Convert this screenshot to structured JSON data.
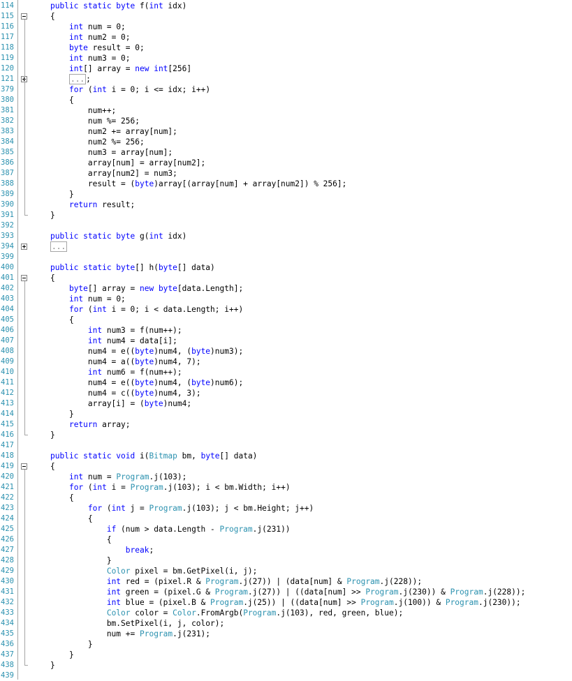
{
  "editor": {
    "language": "C#",
    "colors": {
      "keyword": "#0000ff",
      "type": "#2b91af",
      "line_number": "#2b91af",
      "text": "#000000",
      "collapsed_box": "#a5a5a5",
      "background": "#ffffff"
    },
    "lines": [
      {
        "no": "114",
        "fold": "",
        "code": [
          [
            "kw",
            "public static byte "
          ],
          [
            "n",
            "f("
          ],
          [
            "kw",
            "int "
          ],
          [
            "n",
            "idx)"
          ]
        ]
      },
      {
        "no": "115",
        "fold": "minus",
        "code": [
          [
            "n",
            "{"
          ]
        ]
      },
      {
        "no": "116",
        "fold": "",
        "code": [
          [
            "n",
            "    "
          ],
          [
            "kw",
            "int "
          ],
          [
            "n",
            "num = 0;"
          ]
        ]
      },
      {
        "no": "117",
        "fold": "",
        "code": [
          [
            "n",
            "    "
          ],
          [
            "kw",
            "int "
          ],
          [
            "n",
            "num2 = 0;"
          ]
        ]
      },
      {
        "no": "118",
        "fold": "",
        "code": [
          [
            "n",
            "    "
          ],
          [
            "kw",
            "byte "
          ],
          [
            "n",
            "result = 0;"
          ]
        ]
      },
      {
        "no": "119",
        "fold": "",
        "code": [
          [
            "n",
            "    "
          ],
          [
            "kw",
            "int "
          ],
          [
            "n",
            "num3 = 0;"
          ]
        ]
      },
      {
        "no": "120",
        "fold": "",
        "code": [
          [
            "n",
            "    "
          ],
          [
            "kw",
            "int"
          ],
          [
            "n",
            "[] array = "
          ],
          [
            "kw",
            "new int"
          ],
          [
            "n",
            "[256]"
          ]
        ]
      },
      {
        "no": "121",
        "fold": "plus",
        "code": [
          [
            "n",
            "    "
          ],
          [
            "box",
            "..."
          ],
          [
            "n",
            ";"
          ]
        ]
      },
      {
        "no": "379",
        "fold": "",
        "code": [
          [
            "n",
            "    "
          ],
          [
            "kw",
            "for "
          ],
          [
            "n",
            "("
          ],
          [
            "kw",
            "int "
          ],
          [
            "n",
            "i = 0; i <= idx; i++)"
          ]
        ]
      },
      {
        "no": "380",
        "fold": "",
        "code": [
          [
            "n",
            "    {"
          ]
        ]
      },
      {
        "no": "381",
        "fold": "",
        "code": [
          [
            "n",
            "        num++;"
          ]
        ]
      },
      {
        "no": "382",
        "fold": "",
        "code": [
          [
            "n",
            "        num %= 256;"
          ]
        ]
      },
      {
        "no": "383",
        "fold": "",
        "code": [
          [
            "n",
            "        num2 += array[num];"
          ]
        ]
      },
      {
        "no": "384",
        "fold": "",
        "code": [
          [
            "n",
            "        num2 %= 256;"
          ]
        ]
      },
      {
        "no": "385",
        "fold": "",
        "code": [
          [
            "n",
            "        num3 = array[num];"
          ]
        ]
      },
      {
        "no": "386",
        "fold": "",
        "code": [
          [
            "n",
            "        array[num] = array[num2];"
          ]
        ]
      },
      {
        "no": "387",
        "fold": "",
        "code": [
          [
            "n",
            "        array[num2] = num3;"
          ]
        ]
      },
      {
        "no": "388",
        "fold": "",
        "code": [
          [
            "n",
            "        result = ("
          ],
          [
            "kw",
            "byte"
          ],
          [
            "n",
            ")array[(array[num] + array[num2]) % 256];"
          ]
        ]
      },
      {
        "no": "389",
        "fold": "",
        "code": [
          [
            "n",
            "    }"
          ]
        ]
      },
      {
        "no": "390",
        "fold": "",
        "code": [
          [
            "n",
            "    "
          ],
          [
            "kw",
            "return "
          ],
          [
            "n",
            "result;"
          ]
        ]
      },
      {
        "no": "391",
        "fold": "end",
        "code": [
          [
            "n",
            "}"
          ]
        ]
      },
      {
        "no": "392",
        "fold": "",
        "code": []
      },
      {
        "no": "393",
        "fold": "",
        "code": [
          [
            "kw",
            "public static byte "
          ],
          [
            "n",
            "g("
          ],
          [
            "kw",
            "int "
          ],
          [
            "n",
            "idx)"
          ]
        ]
      },
      {
        "no": "394",
        "fold": "plus",
        "code": [
          [
            "box",
            "..."
          ]
        ]
      },
      {
        "no": "399",
        "fold": "",
        "code": []
      },
      {
        "no": "400",
        "fold": "",
        "code": [
          [
            "kw",
            "public static byte"
          ],
          [
            "n",
            "[] h("
          ],
          [
            "kw",
            "byte"
          ],
          [
            "n",
            "[] data)"
          ]
        ]
      },
      {
        "no": "401",
        "fold": "minus",
        "code": [
          [
            "n",
            "{"
          ]
        ]
      },
      {
        "no": "402",
        "fold": "",
        "code": [
          [
            "n",
            "    "
          ],
          [
            "kw",
            "byte"
          ],
          [
            "n",
            "[] array = "
          ],
          [
            "kw",
            "new byte"
          ],
          [
            "n",
            "[data.Length];"
          ]
        ]
      },
      {
        "no": "403",
        "fold": "",
        "code": [
          [
            "n",
            "    "
          ],
          [
            "kw",
            "int "
          ],
          [
            "n",
            "num = 0;"
          ]
        ]
      },
      {
        "no": "404",
        "fold": "",
        "code": [
          [
            "n",
            "    "
          ],
          [
            "kw",
            "for "
          ],
          [
            "n",
            "("
          ],
          [
            "kw",
            "int "
          ],
          [
            "n",
            "i = 0; i < data.Length; i++)"
          ]
        ]
      },
      {
        "no": "405",
        "fold": "",
        "code": [
          [
            "n",
            "    {"
          ]
        ]
      },
      {
        "no": "406",
        "fold": "",
        "code": [
          [
            "n",
            "        "
          ],
          [
            "kw",
            "int "
          ],
          [
            "n",
            "num3 = f(num++);"
          ]
        ]
      },
      {
        "no": "407",
        "fold": "",
        "code": [
          [
            "n",
            "        "
          ],
          [
            "kw",
            "int "
          ],
          [
            "n",
            "num4 = data[i];"
          ]
        ]
      },
      {
        "no": "408",
        "fold": "",
        "code": [
          [
            "n",
            "        num4 = e(("
          ],
          [
            "kw",
            "byte"
          ],
          [
            "n",
            ")num4, ("
          ],
          [
            "kw",
            "byte"
          ],
          [
            "n",
            ")num3);"
          ]
        ]
      },
      {
        "no": "409",
        "fold": "",
        "code": [
          [
            "n",
            "        num4 = a(("
          ],
          [
            "kw",
            "byte"
          ],
          [
            "n",
            ")num4, 7);"
          ]
        ]
      },
      {
        "no": "410",
        "fold": "",
        "code": [
          [
            "n",
            "        "
          ],
          [
            "kw",
            "int "
          ],
          [
            "n",
            "num6 = f(num++);"
          ]
        ]
      },
      {
        "no": "411",
        "fold": "",
        "code": [
          [
            "n",
            "        num4 = e(("
          ],
          [
            "kw",
            "byte"
          ],
          [
            "n",
            ")num4, ("
          ],
          [
            "kw",
            "byte"
          ],
          [
            "n",
            ")num6);"
          ]
        ]
      },
      {
        "no": "412",
        "fold": "",
        "code": [
          [
            "n",
            "        num4 = c(("
          ],
          [
            "kw",
            "byte"
          ],
          [
            "n",
            ")num4, 3);"
          ]
        ]
      },
      {
        "no": "413",
        "fold": "",
        "code": [
          [
            "n",
            "        array[i] = ("
          ],
          [
            "kw",
            "byte"
          ],
          [
            "n",
            ")num4;"
          ]
        ]
      },
      {
        "no": "414",
        "fold": "",
        "code": [
          [
            "n",
            "    }"
          ]
        ]
      },
      {
        "no": "415",
        "fold": "",
        "code": [
          [
            "n",
            "    "
          ],
          [
            "kw",
            "return "
          ],
          [
            "n",
            "array;"
          ]
        ]
      },
      {
        "no": "416",
        "fold": "end",
        "code": [
          [
            "n",
            "}"
          ]
        ]
      },
      {
        "no": "417",
        "fold": "",
        "code": []
      },
      {
        "no": "418",
        "fold": "",
        "code": [
          [
            "kw",
            "public static void "
          ],
          [
            "n",
            "i("
          ],
          [
            "ty",
            "Bitmap "
          ],
          [
            "n",
            "bm, "
          ],
          [
            "kw",
            "byte"
          ],
          [
            "n",
            "[] data)"
          ]
        ]
      },
      {
        "no": "419",
        "fold": "minus",
        "code": [
          [
            "n",
            "{"
          ]
        ]
      },
      {
        "no": "420",
        "fold": "",
        "code": [
          [
            "n",
            "    "
          ],
          [
            "kw",
            "int "
          ],
          [
            "n",
            "num = "
          ],
          [
            "ty",
            "Program"
          ],
          [
            "n",
            ".j(103);"
          ]
        ]
      },
      {
        "no": "421",
        "fold": "",
        "code": [
          [
            "n",
            "    "
          ],
          [
            "kw",
            "for "
          ],
          [
            "n",
            "("
          ],
          [
            "kw",
            "int "
          ],
          [
            "n",
            "i = "
          ],
          [
            "ty",
            "Program"
          ],
          [
            "n",
            ".j(103); i < bm.Width; i++)"
          ]
        ]
      },
      {
        "no": "422",
        "fold": "",
        "code": [
          [
            "n",
            "    {"
          ]
        ]
      },
      {
        "no": "423",
        "fold": "",
        "code": [
          [
            "n",
            "        "
          ],
          [
            "kw",
            "for "
          ],
          [
            "n",
            "("
          ],
          [
            "kw",
            "int "
          ],
          [
            "n",
            "j = "
          ],
          [
            "ty",
            "Program"
          ],
          [
            "n",
            ".j(103); j < bm.Height; j++)"
          ]
        ]
      },
      {
        "no": "424",
        "fold": "",
        "code": [
          [
            "n",
            "        {"
          ]
        ]
      },
      {
        "no": "425",
        "fold": "",
        "code": [
          [
            "n",
            "            "
          ],
          [
            "kw",
            "if "
          ],
          [
            "n",
            "(num > data.Length - "
          ],
          [
            "ty",
            "Program"
          ],
          [
            "n",
            ".j(231))"
          ]
        ]
      },
      {
        "no": "426",
        "fold": "",
        "code": [
          [
            "n",
            "            {"
          ]
        ]
      },
      {
        "no": "427",
        "fold": "",
        "code": [
          [
            "n",
            "                "
          ],
          [
            "kw",
            "break"
          ],
          [
            "n",
            ";"
          ]
        ]
      },
      {
        "no": "428",
        "fold": "",
        "code": [
          [
            "n",
            "            }"
          ]
        ]
      },
      {
        "no": "429",
        "fold": "",
        "code": [
          [
            "n",
            "            "
          ],
          [
            "ty",
            "Color "
          ],
          [
            "n",
            "pixel = bm.GetPixel(i, j);"
          ]
        ]
      },
      {
        "no": "430",
        "fold": "",
        "code": [
          [
            "n",
            "            "
          ],
          [
            "kw",
            "int "
          ],
          [
            "n",
            "red = (pixel.R & "
          ],
          [
            "ty",
            "Program"
          ],
          [
            "n",
            ".j(27)) | (data[num] & "
          ],
          [
            "ty",
            "Program"
          ],
          [
            "n",
            ".j(228));"
          ]
        ]
      },
      {
        "no": "431",
        "fold": "",
        "code": [
          [
            "n",
            "            "
          ],
          [
            "kw",
            "int "
          ],
          [
            "n",
            "green = (pixel.G & "
          ],
          [
            "ty",
            "Program"
          ],
          [
            "n",
            ".j(27)) | ((data[num] >> "
          ],
          [
            "ty",
            "Program"
          ],
          [
            "n",
            ".j(230)) & "
          ],
          [
            "ty",
            "Program"
          ],
          [
            "n",
            ".j(228));"
          ]
        ]
      },
      {
        "no": "432",
        "fold": "",
        "code": [
          [
            "n",
            "            "
          ],
          [
            "kw",
            "int "
          ],
          [
            "n",
            "blue = (pixel.B & "
          ],
          [
            "ty",
            "Program"
          ],
          [
            "n",
            ".j(25)) | ((data[num] >> "
          ],
          [
            "ty",
            "Program"
          ],
          [
            "n",
            ".j(100)) & "
          ],
          [
            "ty",
            "Program"
          ],
          [
            "n",
            ".j(230));"
          ]
        ]
      },
      {
        "no": "433",
        "fold": "",
        "code": [
          [
            "n",
            "            "
          ],
          [
            "ty",
            "Color "
          ],
          [
            "n",
            "color = "
          ],
          [
            "ty",
            "Color"
          ],
          [
            "n",
            ".FromArgb("
          ],
          [
            "ty",
            "Program"
          ],
          [
            "n",
            ".j(103), red, green, blue);"
          ]
        ]
      },
      {
        "no": "434",
        "fold": "",
        "code": [
          [
            "n",
            "            bm.SetPixel(i, j, color);"
          ]
        ]
      },
      {
        "no": "435",
        "fold": "",
        "code": [
          [
            "n",
            "            num += "
          ],
          [
            "ty",
            "Program"
          ],
          [
            "n",
            ".j(231);"
          ]
        ]
      },
      {
        "no": "436",
        "fold": "",
        "code": [
          [
            "n",
            "        }"
          ]
        ]
      },
      {
        "no": "437",
        "fold": "",
        "code": [
          [
            "n",
            "    }"
          ]
        ]
      },
      {
        "no": "438",
        "fold": "end",
        "code": [
          [
            "n",
            "}"
          ]
        ]
      },
      {
        "no": "439",
        "fold": "",
        "code": []
      }
    ]
  }
}
